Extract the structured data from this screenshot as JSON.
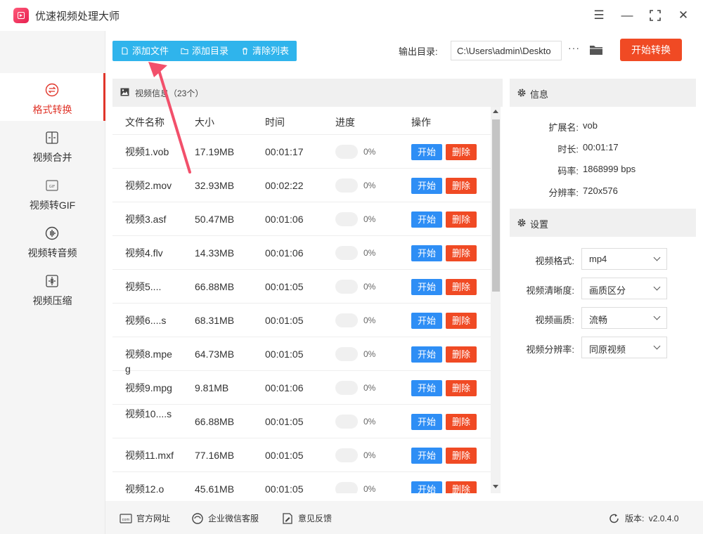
{
  "app": {
    "title": "优速视频处理大师"
  },
  "window_controls": {
    "menu": "☰",
    "minimize": "—",
    "maximize": "⛶",
    "close": "✕"
  },
  "sidebar": {
    "items": [
      {
        "label": "格式转换",
        "icon": "convert-icon",
        "active": true
      },
      {
        "label": "视频合并",
        "icon": "merge-icon"
      },
      {
        "label": "视频转GIF",
        "icon": "gif-icon"
      },
      {
        "label": "视频转音频",
        "icon": "audio-icon"
      },
      {
        "label": "视频压缩",
        "icon": "compress-icon"
      }
    ]
  },
  "toolbar": {
    "add_file": "添加文件",
    "add_folder": "添加目录",
    "clear_list": "清除列表",
    "output_label": "输出目录:",
    "output_path": "C:\\Users\\admin\\Deskto",
    "more": "···",
    "start_convert": "开始转换"
  },
  "file_list": {
    "title": "视频信息（23个）",
    "columns": {
      "name": "文件名称",
      "size": "大小",
      "time": "时间",
      "progress": "进度",
      "action": "操作"
    },
    "start_label": "开始",
    "delete_label": "删除",
    "rows": [
      {
        "name": "视频1.vob",
        "size": "17.19MB",
        "time": "00:01:17",
        "progress": "0%"
      },
      {
        "name": "视频2.mov",
        "size": "32.93MB",
        "time": "00:02:22",
        "progress": "0%"
      },
      {
        "name": "视频3.asf",
        "size": "50.47MB",
        "time": "00:01:06",
        "progress": "0%"
      },
      {
        "name": "视频4.flv",
        "size": "14.33MB",
        "time": "00:01:06",
        "progress": "0%"
      },
      {
        "name": "视频5....",
        "size": "66.88MB",
        "time": "00:01:05",
        "progress": "0%"
      },
      {
        "name": "视频6....s",
        "size": "68.31MB",
        "time": "00:01:05",
        "progress": "0%"
      },
      {
        "name": "视频8.mpeg",
        "size": "64.73MB",
        "time": "00:01:05",
        "progress": "0%"
      },
      {
        "name": "视频9.mpg",
        "size": "9.81MB",
        "time": "00:01:06",
        "progress": "0%"
      },
      {
        "name": "视频10....s",
        "size": "66.88MB",
        "time": "00:01:05",
        "progress": "0%"
      },
      {
        "name": "视频11.mxf",
        "size": "77.16MB",
        "time": "00:01:05",
        "progress": "0%"
      },
      {
        "name": "视频12.o",
        "size": "45.61MB",
        "time": "00:01:05",
        "progress": "0%"
      }
    ]
  },
  "info": {
    "title": "信息",
    "fields": [
      {
        "label": "扩展名:",
        "value": "vob"
      },
      {
        "label": "时长:",
        "value": "00:01:17"
      },
      {
        "label": "码率:",
        "value": "1868999 bps"
      },
      {
        "label": "分辨率:",
        "value": "720x576"
      }
    ]
  },
  "settings": {
    "title": "设置",
    "fields": [
      {
        "label": "视频格式:",
        "value": "mp4"
      },
      {
        "label": "视频清晰度:",
        "value": "画质区分"
      },
      {
        "label": "视频画质:",
        "value": "流畅"
      },
      {
        "label": "视频分辨率:",
        "value": "同原视频"
      }
    ]
  },
  "footer": {
    "website": "官方网址",
    "wechat": "企业微信客服",
    "feedback": "意见反馈",
    "version_label": "版本:",
    "version": "v2.0.4.0"
  },
  "colors": {
    "accent_red": "#e0352a",
    "toolbar_blue": "#2fb4ec",
    "start_blue": "#2e8ef5",
    "delete_red": "#f04a24",
    "annotation_arrow": "#f2506b"
  }
}
